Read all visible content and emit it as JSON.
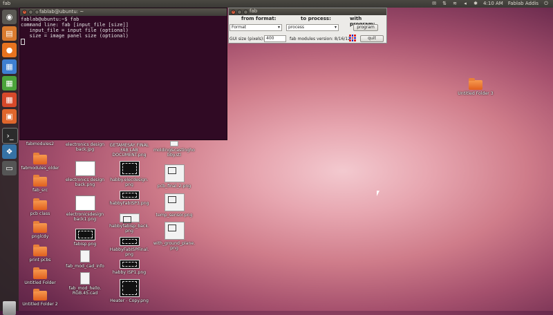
{
  "top_panel": {
    "title": "fab",
    "time": "4:10 AM",
    "user": "Fablab Addis",
    "indicators": [
      "mail-icon",
      "sort-icon",
      "wifi-icon",
      "speaker-icon",
      "bluetooth-icon"
    ]
  },
  "launcher": {
    "items": [
      "dash-home-icon",
      "files-icon",
      "firefox-icon",
      "writer-icon",
      "calc-icon",
      "impress-icon",
      "store-icon",
      "terminal-icon",
      "python-icon",
      "workspace-icon"
    ],
    "trash": "trash-icon"
  },
  "terminal": {
    "title": "fablab@ubuntu: ~",
    "lines": [
      "fablab@ubuntu:~$ fab",
      "command line: fab [input_file [size]]",
      "   input_file = input file (optional)",
      "   size = image panel size (optional)"
    ]
  },
  "fab_window": {
    "title": "fab",
    "from_format_label": "from format:",
    "to_process_label": "to process:",
    "with_program_label": "with program:",
    "format_value": "Format",
    "process_value": "process",
    "program_button": "program",
    "gui_size_label": "GUI size (pixels):",
    "gui_size_value": "400",
    "version_label": "fab modules version: 8/16/12",
    "quit_button": "quit"
  },
  "desktop_icons": {
    "col1": [
      "fabmodules2",
      "fabmodules_older",
      "fab_src",
      "pcb class",
      "pnglcdy",
      "print pcbs",
      "Untitled Folder",
      "Untitled Folder 2"
    ],
    "col2": [
      "electronics design back.jpg",
      "electronics design back.png",
      "electronicsdesign back1.png",
      "fabisp.png",
      "fab_mod_cad_info",
      "fab_mod_hello. RGB.45.cad"
    ],
    "col3": [
      "GETAMESAY FINAL FAB LAB DOCUMENT.png",
      "habby.elecdesign. png",
      "habbyFabISP3.png",
      "habbyfabisp_back. png",
      "HabbyFabISPFinal. png",
      "habby ISP1.png",
      "Heater - Copy.png"
    ],
    "col4": [
      "molding&castingho bby.stl",
      "pcb_final_2.png",
      "temp_sensor.png",
      "with_ground_plane. png"
    ],
    "right": [
      "Untitled Folder 3"
    ]
  }
}
